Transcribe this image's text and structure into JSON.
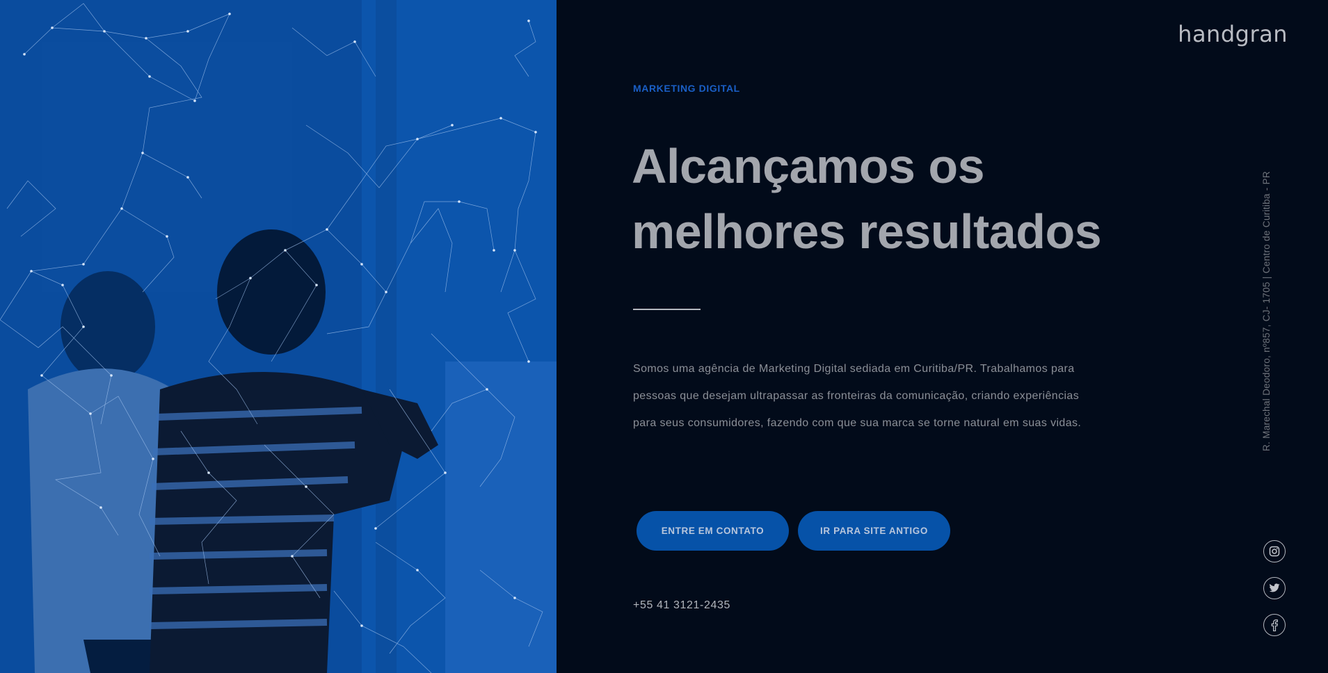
{
  "brand": {
    "logo_text": "handgran"
  },
  "hero": {
    "eyebrow": "MARKETING DIGITAL",
    "headline_line1": "Alcançamos os",
    "headline_line2": "melhores resultados",
    "description": "Somos uma agência de Marketing Digital sediada em Curitiba/PR. Trabalhamos para pessoas que desejam ultrapassar as fronteiras da comunicação, criando experiências para seus consumidores, fazendo com que sua marca se torne natural em suas vidas.",
    "buttons": {
      "contact_label": "ENTRE EM CONTATO",
      "old_site_label": "IR PARA SITE ANTIGO"
    },
    "phone": "+55 41 3121-2435"
  },
  "address": "R. Marechal Deodoro, nº857, CJ- 1705 | Centro de Curitiba - PR",
  "social": [
    {
      "icon": "instagram-icon"
    },
    {
      "icon": "twitter-icon"
    },
    {
      "icon": "facebook-icon"
    }
  ],
  "colors": {
    "background": "#020b1a",
    "accent": "#1a5fc6",
    "button": "#0652a8",
    "image_tint": "#0551a8"
  }
}
